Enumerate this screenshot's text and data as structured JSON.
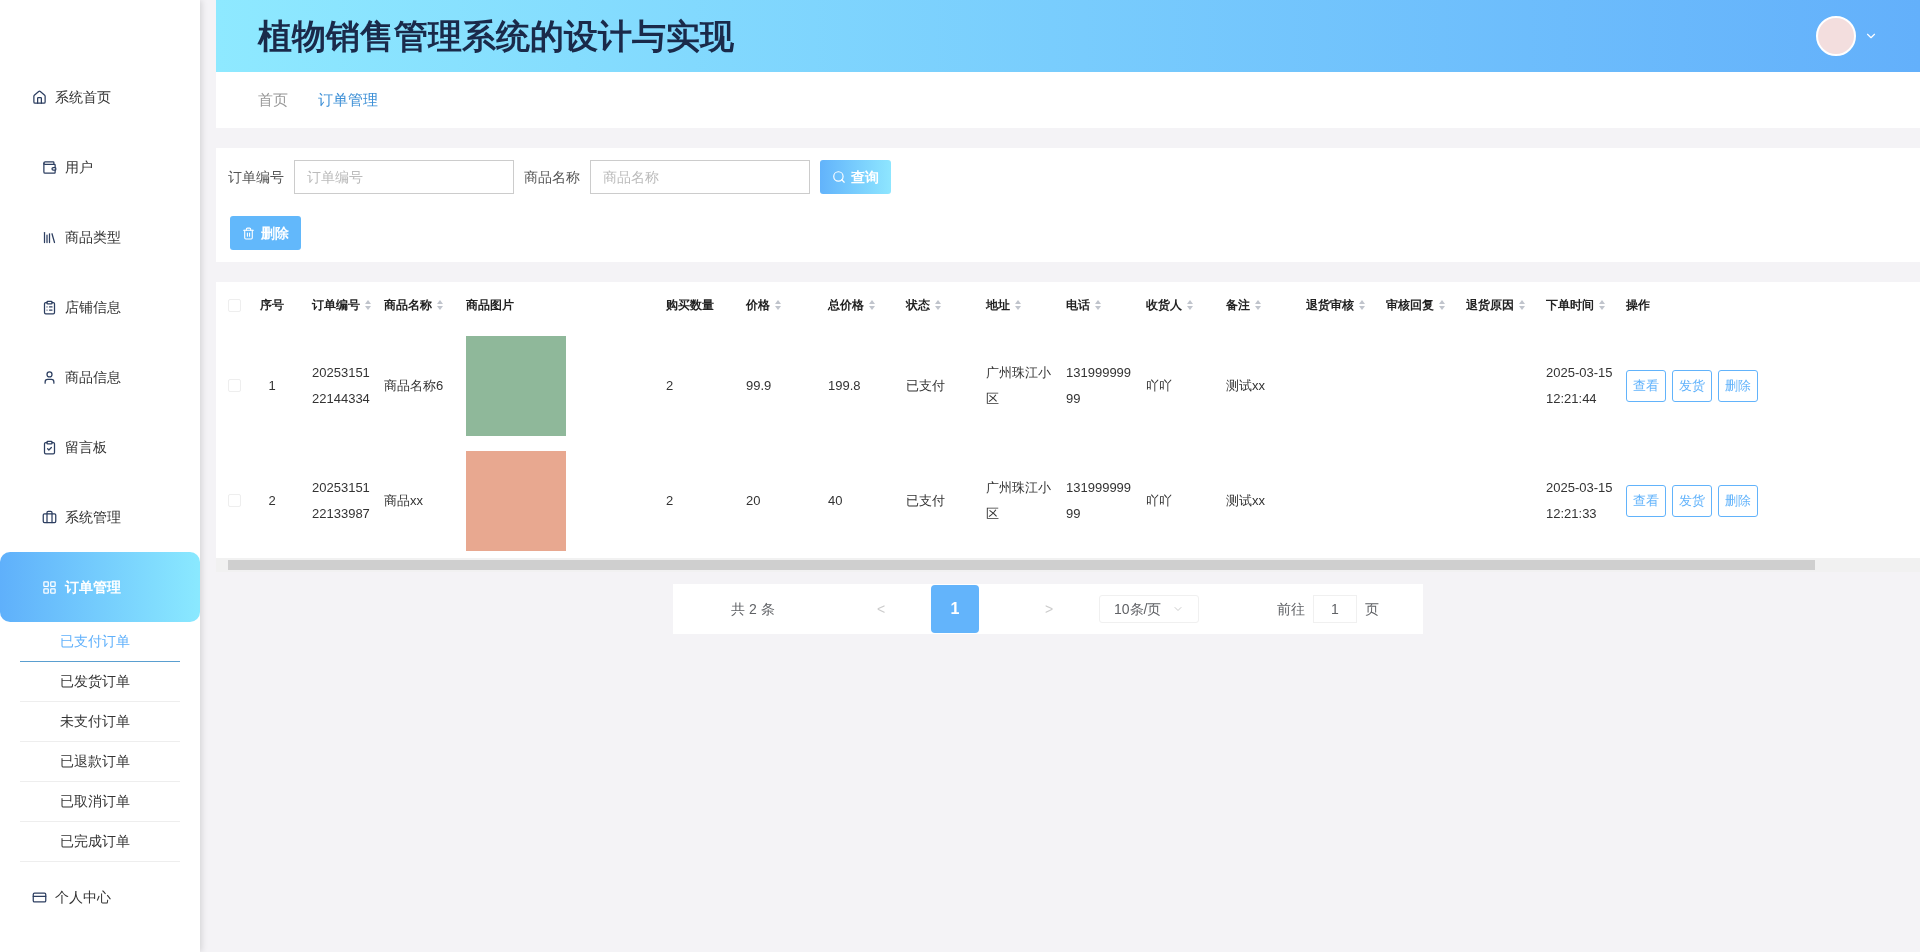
{
  "header": {
    "title": "植物销售管理系统的设计与实现"
  },
  "sidebar": {
    "items": [
      {
        "label": "系统首页",
        "selected": false
      },
      {
        "label": "用户",
        "selected": false
      },
      {
        "label": "商品类型",
        "selected": false
      },
      {
        "label": "店铺信息",
        "selected": false
      },
      {
        "label": "商品信息",
        "selected": false
      },
      {
        "label": "留言板",
        "selected": false
      },
      {
        "label": "系统管理",
        "selected": false
      },
      {
        "label": "订单管理",
        "selected": true,
        "children": [
          {
            "label": "已支付订单",
            "selected": true
          },
          {
            "label": "已发货订单",
            "selected": false
          },
          {
            "label": "未支付订单",
            "selected": false
          },
          {
            "label": "已退款订单",
            "selected": false
          },
          {
            "label": "已取消订单",
            "selected": false
          },
          {
            "label": "已完成订单",
            "selected": false
          }
        ]
      },
      {
        "label": "个人中心",
        "selected": false
      }
    ]
  },
  "breadcrumb": [
    {
      "label": "首页",
      "selected": false
    },
    {
      "label": "订单管理",
      "selected": true
    }
  ],
  "search": {
    "fields": [
      {
        "label": "订单编号",
        "placeholder": "订单编号"
      },
      {
        "label": "商品名称",
        "placeholder": "商品名称"
      }
    ],
    "button": "查询"
  },
  "delete_button": "删除",
  "table": {
    "select_all_checked": false,
    "columns": [
      {
        "label": "序号",
        "sortable": false
      },
      {
        "label": "订单编号",
        "sortable": true
      },
      {
        "label": "商品名称",
        "sortable": true
      },
      {
        "label": "商品图片",
        "sortable": false
      },
      {
        "label": "购买数量",
        "sortable": false
      },
      {
        "label": "价格",
        "sortable": true
      },
      {
        "label": "总价格",
        "sortable": true
      },
      {
        "label": "状态",
        "sortable": true
      },
      {
        "label": "地址",
        "sortable": true
      },
      {
        "label": "电话",
        "sortable": true
      },
      {
        "label": "收货人",
        "sortable": true
      },
      {
        "label": "备注",
        "sortable": true
      },
      {
        "label": "退货审核",
        "sortable": true
      },
      {
        "label": "审核回复",
        "sortable": true
      },
      {
        "label": "退货原因",
        "sortable": true
      },
      {
        "label": "下单时间",
        "sortable": true
      },
      {
        "label": "操作",
        "sortable": false
      }
    ],
    "rows": [
      {
        "checked": false,
        "cells": [
          "1",
          "2025315122144334",
          "商品名称6",
          null,
          "2",
          "99.9",
          "199.8",
          "已支付",
          "广州珠江小区",
          "13199999999",
          "吖吖",
          "测试xx",
          "",
          "",
          "",
          "2025-03-15 12:21:44"
        ],
        "actions": [
          "查看",
          "发货",
          "删除"
        ]
      },
      {
        "checked": false,
        "cells": [
          "2",
          "2025315122133987",
          "商品xx",
          null,
          "2",
          "20",
          "40",
          "已支付",
          "广州珠江小区",
          "13199999999",
          "吖吖",
          "测试xx",
          "",
          "",
          "",
          "2025-03-15 12:21:33"
        ],
        "actions": [
          "查看",
          "发货",
          "删除"
        ]
      }
    ]
  },
  "pagination": {
    "total": "共 2 条",
    "prev": "<",
    "pages": [
      {
        "label": "1",
        "selected": true
      }
    ],
    "next": ">",
    "page_size": "10条/页",
    "goto_label": "前往",
    "goto_value": "1",
    "goto_suffix": "页"
  }
}
